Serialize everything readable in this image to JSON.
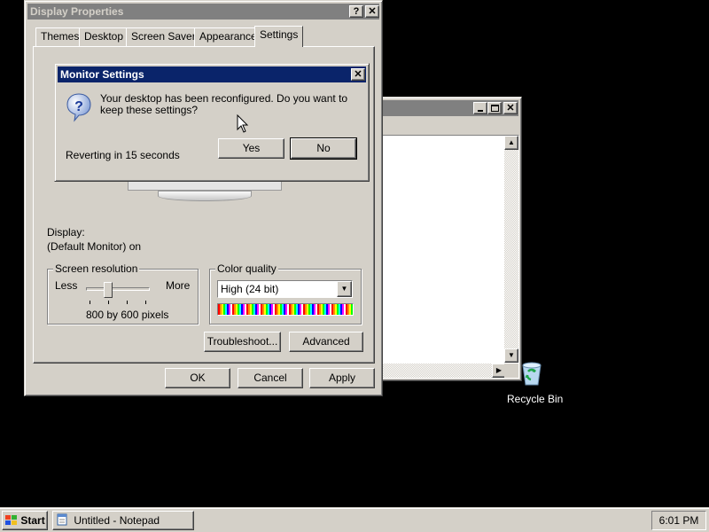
{
  "notepad": {
    "title": ""
  },
  "display_properties": {
    "title": "Display Properties",
    "help_symbol": "?",
    "close_symbol": "✕",
    "tabs": [
      {
        "label": "Themes"
      },
      {
        "label": "Desktop"
      },
      {
        "label": "Screen Saver"
      },
      {
        "label": "Appearance"
      },
      {
        "label": "Settings"
      }
    ],
    "selected_tab": "Settings",
    "display_label": "Display:",
    "display_value": "(Default Monitor) on",
    "screen_resolution": {
      "group_label": "Screen resolution",
      "less_label": "Less",
      "more_label": "More",
      "value_text": "800 by 600 pixels",
      "slider_level": 0.33
    },
    "color_quality": {
      "group_label": "Color quality",
      "selected": "High (24 bit)"
    },
    "troubleshoot_label": "Troubleshoot...",
    "advanced_label": "Advanced",
    "ok_label": "OK",
    "cancel_label": "Cancel",
    "apply_label": "Apply"
  },
  "monitor_settings": {
    "title": "Monitor Settings",
    "message": "Your desktop has been reconfigured.  Do you want to keep these settings?",
    "countdown": "Reverting in 15 seconds",
    "yes_label": "Yes",
    "no_label": "No",
    "icon": "question-icon"
  },
  "desktop": {
    "recycle_bin_label": "Recycle Bin"
  },
  "taskbar": {
    "start_label": "Start",
    "task_label": "Untitled - Notepad",
    "clock": "6:01 PM"
  },
  "colors": {
    "active_title": "#0a246a",
    "inactive_title": "#808080",
    "face": "#d4d0c8",
    "desktop": "#000000"
  }
}
